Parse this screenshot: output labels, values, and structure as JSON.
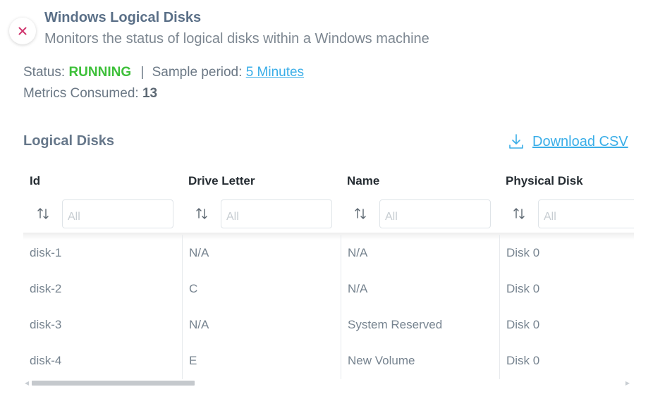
{
  "header": {
    "title": "Windows Logical Disks",
    "subtitle": "Monitors the status of logical disks within a Windows machine",
    "close_icon": "close-x-icon",
    "close_color": "#d0366e"
  },
  "status": {
    "label": "Status:",
    "value": "RUNNING",
    "value_color": "#3ec03a",
    "separator": "|",
    "sample_label": "Sample period:",
    "sample_value": "5 Minutes"
  },
  "metrics": {
    "label": "Metrics Consumed:",
    "value": "13"
  },
  "section": {
    "title": "Logical Disks",
    "download_label": "Download CSV",
    "download_icon": "download-icon",
    "link_color": "#3aaee8"
  },
  "table": {
    "columns": [
      {
        "label": "Id",
        "filter_placeholder": "All"
      },
      {
        "label": "Drive Letter",
        "filter_placeholder": "All"
      },
      {
        "label": "Name",
        "filter_placeholder": "All"
      },
      {
        "label": "Physical Disk",
        "filter_placeholder": "All"
      }
    ],
    "rows": [
      [
        "disk-1",
        "N/A",
        "N/A",
        "Disk 0"
      ],
      [
        "disk-2",
        "C",
        "N/A",
        "Disk 0"
      ],
      [
        "disk-3",
        "N/A",
        "System Reserved",
        "Disk 0"
      ],
      [
        "disk-4",
        "E",
        "New Volume",
        "Disk 0"
      ]
    ],
    "sort_icon": "sort-arrows-icon"
  }
}
